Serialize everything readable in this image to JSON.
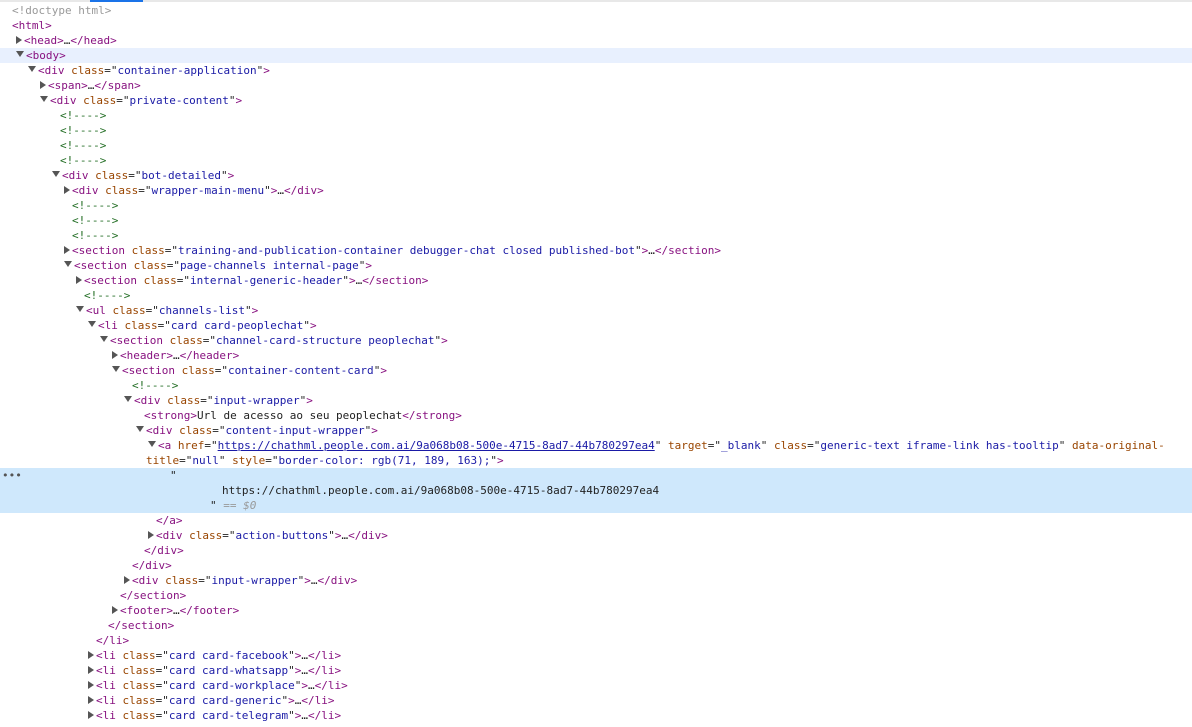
{
  "doctype": "<!doctype html>",
  "lines": [
    {
      "indent": 12,
      "tri": "none",
      "kind": "doc",
      "text": "<!doctype html>"
    },
    {
      "indent": 12,
      "tri": "none",
      "kind": "open",
      "tag": "html"
    },
    {
      "indent": 16,
      "tri": "closed",
      "kind": "collapsed",
      "tag": "head"
    },
    {
      "indent": 16,
      "tri": "open",
      "kind": "open",
      "tag": "body",
      "sel": true
    },
    {
      "indent": 28,
      "tri": "open",
      "kind": "open",
      "tag": "div",
      "attrs": [
        [
          "class",
          "container-application"
        ]
      ]
    },
    {
      "indent": 40,
      "tri": "closed",
      "kind": "collapsed",
      "tag": "span"
    },
    {
      "indent": 40,
      "tri": "open",
      "kind": "open",
      "tag": "div",
      "attrs": [
        [
          "class",
          "private-content"
        ]
      ]
    },
    {
      "indent": 60,
      "tri": "none",
      "kind": "comment",
      "text": "<!---->"
    },
    {
      "indent": 60,
      "tri": "none",
      "kind": "comment",
      "text": "<!---->"
    },
    {
      "indent": 60,
      "tri": "none",
      "kind": "comment",
      "text": "<!---->"
    },
    {
      "indent": 60,
      "tri": "none",
      "kind": "comment",
      "text": "<!---->"
    },
    {
      "indent": 52,
      "tri": "open",
      "kind": "open",
      "tag": "div",
      "attrs": [
        [
          "class",
          "bot-detailed"
        ]
      ]
    },
    {
      "indent": 64,
      "tri": "closed",
      "kind": "collapsed",
      "tag": "div",
      "attrs": [
        [
          "class",
          "wrapper-main-menu"
        ]
      ]
    },
    {
      "indent": 72,
      "tri": "none",
      "kind": "comment",
      "text": "<!---->"
    },
    {
      "indent": 72,
      "tri": "none",
      "kind": "comment",
      "text": "<!---->"
    },
    {
      "indent": 72,
      "tri": "none",
      "kind": "comment",
      "text": "<!---->"
    },
    {
      "indent": 64,
      "tri": "closed",
      "kind": "collapsed",
      "tag": "section",
      "attrs": [
        [
          "class",
          "training-and-publication-container debugger-chat closed published-bot"
        ]
      ]
    },
    {
      "indent": 64,
      "tri": "open",
      "kind": "open",
      "tag": "section",
      "attrs": [
        [
          "class",
          "page-channels internal-page"
        ]
      ]
    },
    {
      "indent": 76,
      "tri": "closed",
      "kind": "collapsed",
      "tag": "section",
      "attrs": [
        [
          "class",
          "internal-generic-header"
        ]
      ]
    },
    {
      "indent": 84,
      "tri": "none",
      "kind": "comment",
      "text": "<!---->"
    },
    {
      "indent": 76,
      "tri": "open",
      "kind": "open",
      "tag": "ul",
      "attrs": [
        [
          "class",
          "channels-list"
        ]
      ]
    },
    {
      "indent": 88,
      "tri": "open",
      "kind": "open",
      "tag": "li",
      "attrs": [
        [
          "class",
          "card card-peoplechat"
        ]
      ]
    },
    {
      "indent": 100,
      "tri": "open",
      "kind": "open",
      "tag": "section",
      "attrs": [
        [
          "class",
          "channel-card-structure peoplechat"
        ]
      ]
    },
    {
      "indent": 112,
      "tri": "closed",
      "kind": "collapsed",
      "tag": "header"
    },
    {
      "indent": 112,
      "tri": "open",
      "kind": "open",
      "tag": "section",
      "attrs": [
        [
          "class",
          "container-content-card"
        ]
      ]
    },
    {
      "indent": 132,
      "tri": "none",
      "kind": "comment",
      "text": "<!---->"
    },
    {
      "indent": 124,
      "tri": "open",
      "kind": "open",
      "tag": "div",
      "attrs": [
        [
          "class",
          "input-wrapper"
        ]
      ]
    },
    {
      "indent": 144,
      "tri": "none",
      "kind": "inline",
      "tag": "strong",
      "text": "Url de acesso ao seu peoplechat"
    },
    {
      "indent": 136,
      "tri": "open",
      "kind": "open",
      "tag": "div",
      "attrs": [
        [
          "class",
          "content-input-wrapper"
        ]
      ]
    },
    {
      "indent": 148,
      "tri": "open",
      "kind": "anchor"
    },
    {
      "indent": 146,
      "tri": "none",
      "kind": "anchor2"
    },
    {
      "indent": 170,
      "tri": "none",
      "kind": "quote",
      "text": "\"",
      "selblock": true,
      "dots": true
    },
    {
      "indent": 222,
      "tri": "none",
      "kind": "plain",
      "text": "https://chathml.people.com.ai/9a068b08-500e-4715-8ad7-44b780297ea4",
      "selblock": true
    },
    {
      "indent": 210,
      "tri": "none",
      "kind": "eqline",
      "text": "\"",
      "eq": "== $0",
      "selblock": true
    },
    {
      "indent": 156,
      "tri": "none",
      "kind": "close",
      "tag": "a"
    },
    {
      "indent": 148,
      "tri": "closed",
      "kind": "collapsed",
      "tag": "div",
      "attrs": [
        [
          "class",
          "action-buttons"
        ]
      ]
    },
    {
      "indent": 144,
      "tri": "none",
      "kind": "close",
      "tag": "div"
    },
    {
      "indent": 132,
      "tri": "none",
      "kind": "close",
      "tag": "div"
    },
    {
      "indent": 124,
      "tri": "closed",
      "kind": "collapsed",
      "tag": "div",
      "attrs": [
        [
          "class",
          "input-wrapper"
        ]
      ]
    },
    {
      "indent": 120,
      "tri": "none",
      "kind": "close",
      "tag": "section"
    },
    {
      "indent": 112,
      "tri": "closed",
      "kind": "collapsed",
      "tag": "footer"
    },
    {
      "indent": 108,
      "tri": "none",
      "kind": "close",
      "tag": "section"
    },
    {
      "indent": 96,
      "tri": "none",
      "kind": "close",
      "tag": "li"
    },
    {
      "indent": 88,
      "tri": "closed",
      "kind": "collapsed",
      "tag": "li",
      "attrs": [
        [
          "class",
          "card card-facebook"
        ]
      ]
    },
    {
      "indent": 88,
      "tri": "closed",
      "kind": "collapsed",
      "tag": "li",
      "attrs": [
        [
          "class",
          "card card-whatsapp"
        ]
      ]
    },
    {
      "indent": 88,
      "tri": "closed",
      "kind": "collapsed",
      "tag": "li",
      "attrs": [
        [
          "class",
          "card card-workplace"
        ]
      ]
    },
    {
      "indent": 88,
      "tri": "closed",
      "kind": "collapsed",
      "tag": "li",
      "attrs": [
        [
          "class",
          "card card-generic"
        ]
      ]
    },
    {
      "indent": 88,
      "tri": "closed",
      "kind": "collapsed",
      "tag": "li",
      "attrs": [
        [
          "class",
          "card card-telegram"
        ]
      ]
    }
  ],
  "anchor": {
    "href": "https://chathml.people.com.ai/9a068b08-500e-4715-8ad7-44b780297ea4",
    "target": "_blank",
    "class": "generic-text iframe-link has-tooltip",
    "data_original_title": "null",
    "style": "border-color: rgb(71, 189, 163);"
  }
}
